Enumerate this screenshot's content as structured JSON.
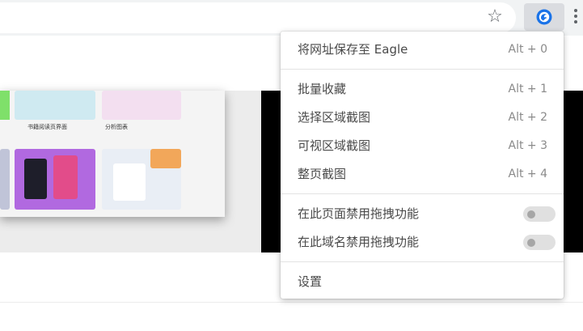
{
  "browser": {
    "bookmark_icon": "star-outline-icon",
    "extension_icon": "eagle-logo-icon",
    "menu_icon": "kebab-menu-icon"
  },
  "page": {
    "preview_cards": [
      {
        "label": "书籍阅读页界面"
      },
      {
        "label": "分析图表"
      }
    ]
  },
  "menu": {
    "save_url": {
      "label": "将网址保存至 Eagle",
      "shortcut": "Alt + 0"
    },
    "batch_collect": {
      "label": "批量收藏",
      "shortcut": "Alt + 1"
    },
    "area_capture": {
      "label": "选择区域截图",
      "shortcut": "Alt + 2"
    },
    "visible_capture": {
      "label": "可视区域截图",
      "shortcut": "Alt + 3"
    },
    "full_capture": {
      "label": "整页截图",
      "shortcut": "Alt + 4"
    },
    "disable_drag_page": {
      "label": "在此页面禁用拖拽功能",
      "enabled": false
    },
    "disable_drag_domain": {
      "label": "在此域名禁用拖拽功能",
      "enabled": false
    },
    "settings": {
      "label": "设置"
    }
  },
  "colors": {
    "toolbar_bg": "#f1f3f4",
    "extension_button_bg": "#dadce0",
    "eagle_blue": "#1a73e8",
    "menu_text": "#4a4a4a",
    "shortcut_text": "#8a8a8a"
  }
}
